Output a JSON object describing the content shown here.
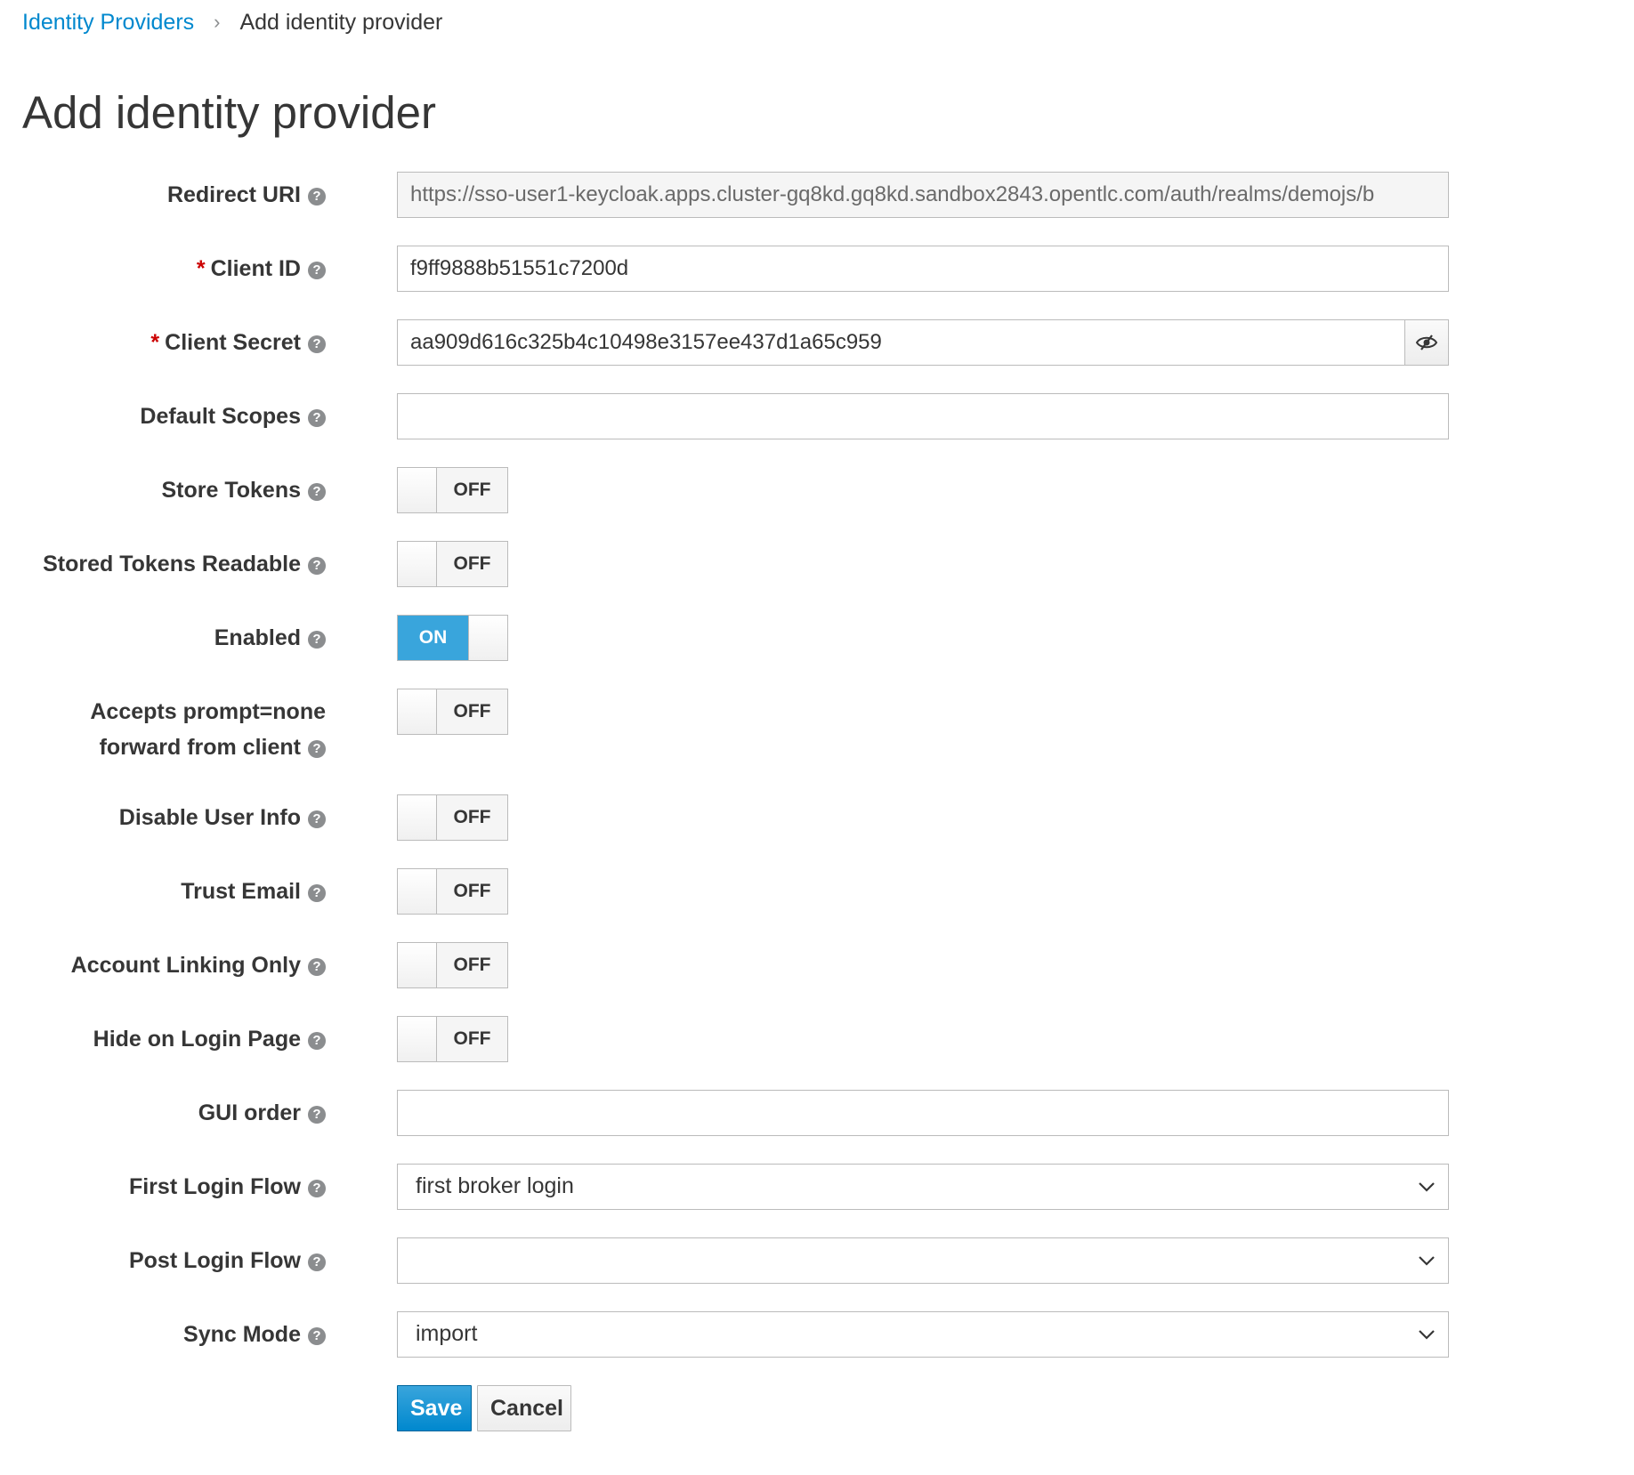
{
  "breadcrumb": {
    "parent": "Identity Providers",
    "separator": "›",
    "current": "Add identity provider"
  },
  "page_title": "Add identity provider",
  "help_icon_glyph": "?",
  "form": {
    "redirect_uri": {
      "label": "Redirect URI",
      "value": "https://sso-user1-keycloak.apps.cluster-gq8kd.gq8kd.sandbox2843.opentlc.com/auth/realms/demojs/b"
    },
    "client_id": {
      "label": "Client ID",
      "required_mark": "*",
      "value": "f9ff9888b51551c7200d"
    },
    "client_secret": {
      "label": "Client Secret",
      "required_mark": "*",
      "value": "aa909d616c325b4c10498e3157ee437d1a65c959",
      "toggle_icon": "eye-slash-icon"
    },
    "default_scopes": {
      "label": "Default Scopes",
      "value": ""
    },
    "store_tokens": {
      "label": "Store Tokens",
      "state": "OFF"
    },
    "stored_tokens_readable": {
      "label": "Stored Tokens Readable",
      "state": "OFF"
    },
    "enabled": {
      "label": "Enabled",
      "state": "ON"
    },
    "accepts_prompt_none": {
      "label_line1": "Accepts prompt=none",
      "label_line2": "forward from client",
      "state": "OFF"
    },
    "disable_user_info": {
      "label": "Disable User Info",
      "state": "OFF"
    },
    "trust_email": {
      "label": "Trust Email",
      "state": "OFF"
    },
    "account_linking_only": {
      "label": "Account Linking Only",
      "state": "OFF"
    },
    "hide_on_login_page": {
      "label": "Hide on Login Page",
      "state": "OFF"
    },
    "gui_order": {
      "label": "GUI order",
      "value": ""
    },
    "first_login_flow": {
      "label": "First Login Flow",
      "selected": "first broker login"
    },
    "post_login_flow": {
      "label": "Post Login Flow",
      "selected": ""
    },
    "sync_mode": {
      "label": "Sync Mode",
      "selected": "import"
    }
  },
  "buttons": {
    "save": "Save",
    "cancel": "Cancel"
  },
  "colors": {
    "link": "#0088ce",
    "toggle_on": "#39a5dc",
    "primary_button": "#0088ce",
    "required": "#cc0000"
  }
}
